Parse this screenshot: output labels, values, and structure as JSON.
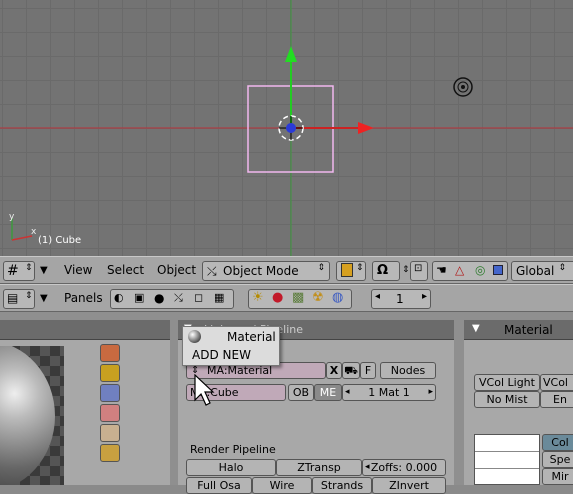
{
  "viewport": {
    "object_label": "(1) Cube",
    "axis_x": "x",
    "axis_y": "y"
  },
  "view3d_header": {
    "menus": [
      "View",
      "Select",
      "Object"
    ],
    "mode": "Object Mode",
    "orientation": "Global"
  },
  "buttons_header": {
    "panels_label": "Panels",
    "frame": "1"
  },
  "links_panel": {
    "title": "Links and Pipeline",
    "tooltip": "Material",
    "add_new": "ADD NEW",
    "material_name": "MA:Material",
    "x_btn": "X",
    "f_btn": "F",
    "nodes_btn": "Nodes",
    "mesh_name": "ME:Cube",
    "ob_btn": "OB",
    "me_btn": "ME",
    "mat_index": "1 Mat 1",
    "render_pipeline": "Render Pipeline",
    "halo": "Halo",
    "ztransp": "ZTransp",
    "zoffs": "Zoffs: 0.000",
    "full_osa": "Full Osa",
    "wire": "Wire",
    "strands": "Strands",
    "zinvert": "ZInvert"
  },
  "material_panel": {
    "title": "Material",
    "vcol_light": "VCol Light",
    "vcol_paint": "VCol",
    "no_mist": "No Mist",
    "env": "En",
    "col": "Col",
    "spe": "Spe",
    "mir": "Mir"
  }
}
